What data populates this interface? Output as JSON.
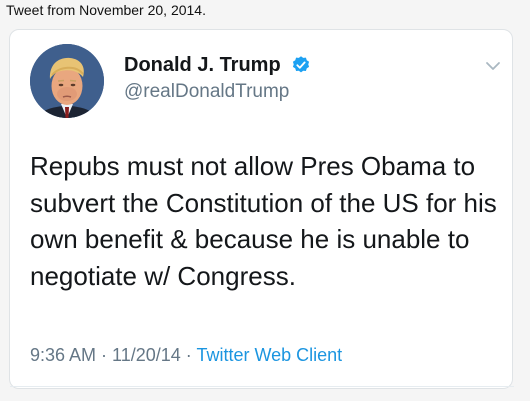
{
  "caption": "Tweet from November 20, 2014.",
  "tweet": {
    "display_name": "Donald J. Trump",
    "verified_icon": "verified-badge-icon",
    "handle": "@realDonaldTrump",
    "text": "Repubs must not allow Pres Obama to subvert the Constitution of the US for his own benefit & because he is unable to negotiate w/ Congress.",
    "time": "9:36 AM",
    "separator": " · ",
    "date": "11/20/14",
    "source": "Twitter Web Client",
    "menu_icon": "chevron-down-icon"
  },
  "colors": {
    "link": "#1b95e0",
    "text_primary": "#14171a",
    "text_secondary": "#657786",
    "verified": "#1da1f2"
  }
}
